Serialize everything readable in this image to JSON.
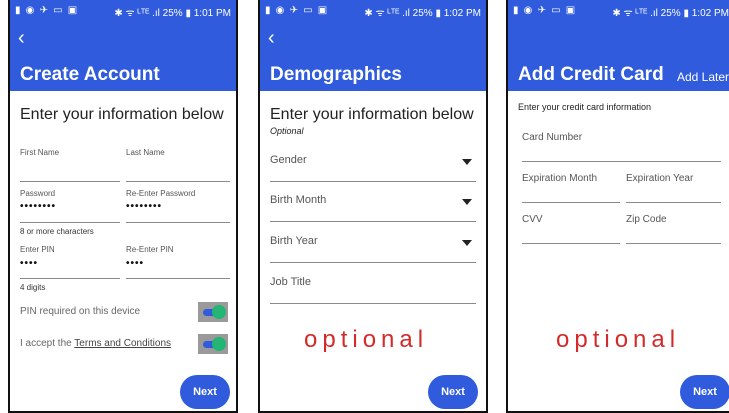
{
  "status_bar": {
    "left_icons": "▮ ◉ ✈ ▭ ▣",
    "screen1_right": "✱ ᯤ ᴸᵀᴱ .ıl 25% ▮ 1:01 PM",
    "screen2_right": "✱ ᯤ ᴸᵀᴱ .ıl 25% ▮ 1:02 PM",
    "screen3_right": "✱ ᯤ ᴸᵀᴱ .ıl 25% ▮ 1:02 PM"
  },
  "colors": {
    "appbar": "#2f5bdc",
    "optional": "#d42a2a",
    "toggle_knob": "#22b573"
  },
  "screen1": {
    "back_icon": "‹",
    "title": "Create Account",
    "heading": "Enter your information below",
    "first_name": {
      "label": "First Name"
    },
    "last_name": {
      "label": "Last Name"
    },
    "password": {
      "label": "Password",
      "value": "••••••••"
    },
    "reenter_password": {
      "label": "Re-Enter Password",
      "value": "••••••••"
    },
    "password_hint": "8 or more characters",
    "pin": {
      "label": "Enter PIN",
      "value": "••••"
    },
    "reenter_pin": {
      "label": "Re-Enter PIN",
      "value": "••••"
    },
    "pin_hint": "4 digits",
    "pin_toggle": {
      "label": "PIN required on this device",
      "on": true
    },
    "terms_toggle": {
      "prefix": "I accept the ",
      "link": "Terms and Conditions",
      "on": true
    },
    "next": "Next"
  },
  "screen2": {
    "back_icon": "‹",
    "title": "Demographics",
    "heading": "Enter your information below",
    "subheading": "Optional",
    "gender": "Gender",
    "birth_month": "Birth Month",
    "birth_year": "Birth Year",
    "job_title": "Job Title",
    "overlay": "optional",
    "next": "Next"
  },
  "screen3": {
    "title": "Add Credit Card",
    "add_later": "Add Later",
    "heading": "Enter your credit card information",
    "card_number": "Card Number",
    "expiration_month": "Expiration Month",
    "expiration_year": "Expiration Year",
    "cvv": "CVV",
    "zip_code": "Zip Code",
    "overlay": "optional",
    "next": "Next"
  }
}
